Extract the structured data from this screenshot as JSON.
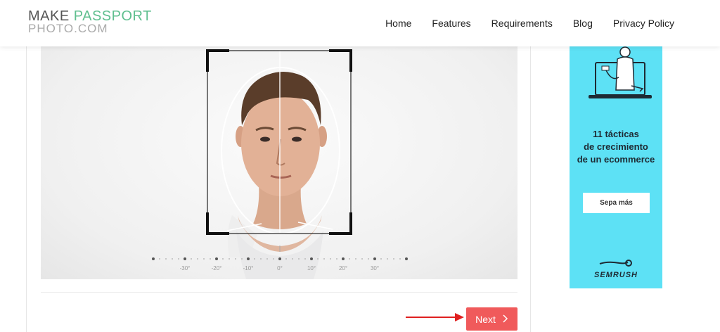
{
  "logo": {
    "line1_main": "MAKE ",
    "line1_accent": "PASSPORT",
    "line2": "PHOTO.COM"
  },
  "nav": {
    "items": [
      "Home",
      "Features",
      "Requirements",
      "Blog",
      "Privacy Policy"
    ]
  },
  "angle_scale": {
    "labels": [
      "-30°",
      "-20°",
      "-10°",
      "0°",
      "10°",
      "20°",
      "30°"
    ]
  },
  "next_button": {
    "label": "Next"
  },
  "ad": {
    "headline_lines": [
      "11 tácticas",
      "de crecimiento",
      "de un ecommerce"
    ],
    "cta": "Sepa más",
    "brand": "SEMRUSH"
  },
  "colors": {
    "accent": "#5fbf8f",
    "next_button": "#f05a5b",
    "ad_background": "#5de1f5",
    "arrow": "#e02020"
  }
}
